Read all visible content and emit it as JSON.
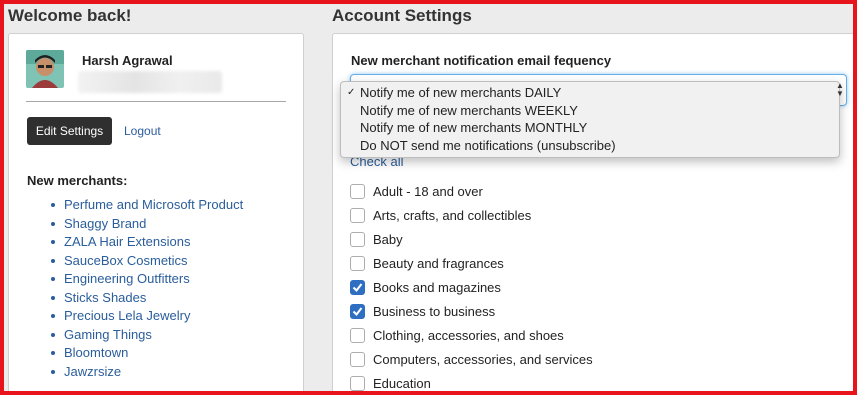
{
  "left": {
    "title": "Welcome back!",
    "user": {
      "name": "Harsh Agrawal"
    },
    "edit_settings": "Edit Settings",
    "logout": "Logout",
    "merchants_heading": "New merchants:",
    "merchants": [
      "Perfume and Microsoft Product",
      "Shaggy Brand",
      "ZALA Hair Extensions",
      "SauceBox Cosmetics",
      "Engineering Outfitters",
      "Sticks Shades",
      "Precious Lela Jewelry",
      "Gaming Things",
      "Bloomtown",
      "Jawzrsize"
    ]
  },
  "right": {
    "title": "Account Settings",
    "frequency_label": "New merchant notification email fequency",
    "options": [
      {
        "label": "Notify me of new merchants DAILY",
        "selected": true
      },
      {
        "label": "Notify me of new merchants WEEKLY",
        "selected": false
      },
      {
        "label": "Notify me of new merchants MONTHLY",
        "selected": false
      },
      {
        "label": "Do NOT send me notifications (unsubscribe)",
        "selected": false
      }
    ],
    "check_all": "Check all",
    "categories": [
      {
        "label": "Adult - 18 and over",
        "checked": false
      },
      {
        "label": "Arts, crafts, and collectibles",
        "checked": false
      },
      {
        "label": "Baby",
        "checked": false
      },
      {
        "label": "Beauty and fragrances",
        "checked": false
      },
      {
        "label": "Books and magazines",
        "checked": true
      },
      {
        "label": "Business to business",
        "checked": true
      },
      {
        "label": "Clothing, accessories, and shoes",
        "checked": false
      },
      {
        "label": "Computers, accessories, and services",
        "checked": false
      },
      {
        "label": "Education",
        "checked": false
      }
    ]
  },
  "colors": {
    "accent": "#2f6fc1",
    "link": "#2a5d9b",
    "frame": "#e8141c"
  },
  "icons": {
    "selected_option": "checkmark-icon",
    "select_toggle": "up-down-arrows-icon"
  }
}
